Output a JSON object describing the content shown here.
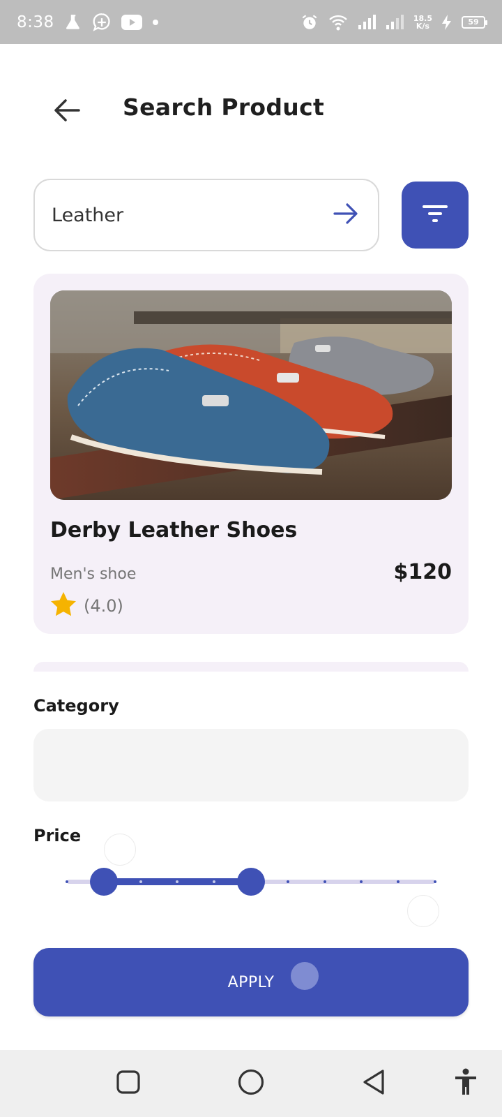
{
  "status_bar": {
    "time": "8:38",
    "net_speed_value": "18.5",
    "net_speed_unit": "K/s",
    "battery": "59"
  },
  "header": {
    "title": "Search Product",
    "back_icon": "arrow-left-icon"
  },
  "search": {
    "value": "Leather",
    "go_icon": "arrow-right-icon",
    "filter_icon": "filter-icon"
  },
  "product": {
    "name": "Derby Leather Shoes",
    "category": "Men's shoe",
    "price": "$120",
    "rating": "(4.0)"
  },
  "filters": {
    "category_label": "Category",
    "category_value": "",
    "price_label": "Price",
    "price_range": {
      "divisions": 10,
      "low_step": 1,
      "high_step": 5
    }
  },
  "apply": {
    "label": "APPLY"
  },
  "colors": {
    "accent": "#3f51b5",
    "card_bg": "#f5f0f8",
    "star": "#f5b301"
  }
}
